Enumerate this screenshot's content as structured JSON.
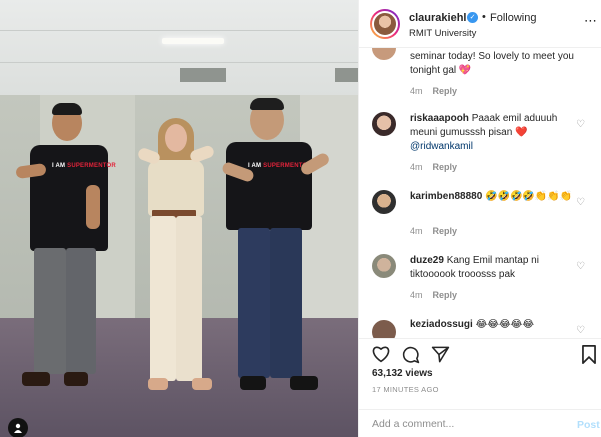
{
  "post": {
    "username": "claurakiehl",
    "verified_icon": "verified-badge-icon",
    "separator": "•",
    "follow_status": "Following",
    "location": "RMIT University",
    "more_icon": "more-options-icon"
  },
  "media": {
    "shirt_prefix": "I AM",
    "shirt_brand": "SUPERMENTOR",
    "colors": {
      "shirt": "#151518",
      "brand_red": "#e2233a"
    }
  },
  "comments": [
    {
      "username": "",
      "text": "seminar today! So lovely to meet you tonight gal 💖",
      "time": "4m",
      "reply": "Reply"
    },
    {
      "username": "riskaaapooh",
      "text": "Paaak emil aduuuh meuni gumusssh pisan ❤️",
      "mention": "@ridwankamil",
      "time": "4m",
      "reply": "Reply"
    },
    {
      "username": "karimben88880",
      "text": "🤣🤣🤣🤣👏👏👏",
      "time": "4m",
      "reply": "Reply"
    },
    {
      "username": "duze29",
      "text": "Kang Emil mantap ni tiktoooook trooosss pak",
      "time": "4m",
      "reply": "Reply"
    },
    {
      "username": "keziadossugi",
      "text": "😂😂😂😂😂",
      "time": "",
      "reply": ""
    }
  ],
  "actions": {
    "like_icon": "heart-icon",
    "comment_icon": "comment-bubble-icon",
    "share_icon": "send-icon",
    "save_icon": "bookmark-icon"
  },
  "likes": "63,132 views",
  "time_ago": "17 MINUTES AGO",
  "add_comment": {
    "placeholder": "Add a comment...",
    "post_label": "Post"
  },
  "colors": {
    "link": "#00376b",
    "muted": "#8e8e8e",
    "post_btn": "#b2dffc",
    "verified": "#3897f0"
  }
}
